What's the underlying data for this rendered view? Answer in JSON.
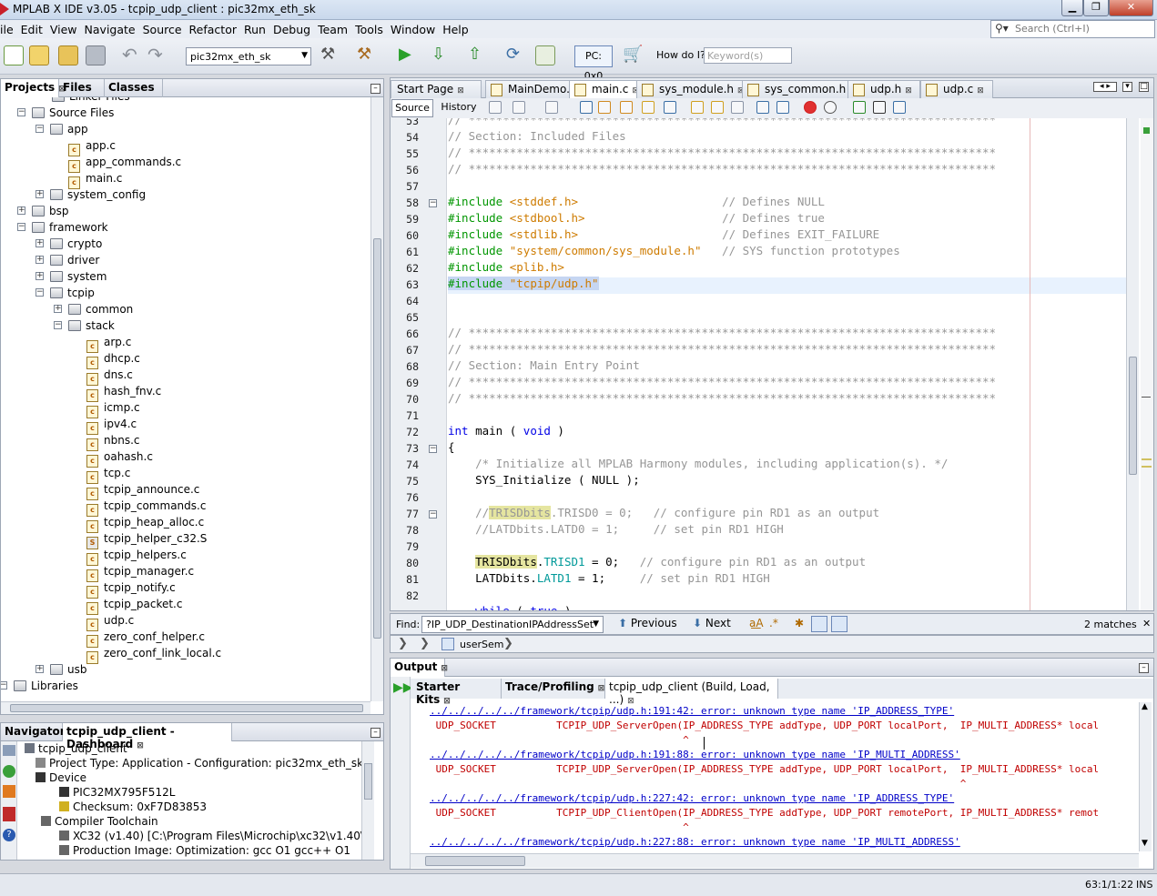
{
  "window": {
    "title": "MPLAB X IDE v3.05 - tcpip_udp_client : pic32mx_eth_sk",
    "min": "▁",
    "max": "❐",
    "close": "✕"
  },
  "menu": [
    "ile",
    "Edit",
    "View",
    "Navigate",
    "Source",
    "Refactor",
    "Run",
    "Debug",
    "Team",
    "Tools",
    "Window",
    "Help"
  ],
  "search": {
    "placeholder": "Search (Ctrl+I)"
  },
  "toolbar": {
    "config": "pic32mx_eth_sk",
    "pc": "PC: 0x0",
    "howdo": "How do I?",
    "keyword_placeholder": "Keyword(s)"
  },
  "projects": {
    "tabs": [
      "Projects",
      "Files",
      "Classes"
    ],
    "tree": [
      {
        "label": "Linker Files",
        "type": "folder"
      },
      {
        "label": "Source Files",
        "type": "folder"
      },
      {
        "label": "app",
        "type": "folder"
      },
      {
        "label": "app.c",
        "type": "file"
      },
      {
        "label": "app_commands.c",
        "type": "file"
      },
      {
        "label": "main.c",
        "type": "file"
      },
      {
        "label": "system_config",
        "type": "folder"
      },
      {
        "label": "bsp",
        "type": "folder"
      },
      {
        "label": "framework",
        "type": "folder"
      },
      {
        "label": "crypto",
        "type": "folder"
      },
      {
        "label": "driver",
        "type": "folder"
      },
      {
        "label": "system",
        "type": "folder"
      },
      {
        "label": "tcpip",
        "type": "folder"
      },
      {
        "label": "common",
        "type": "folder"
      },
      {
        "label": "stack",
        "type": "folder"
      },
      {
        "label": "arp.c",
        "type": "file"
      },
      {
        "label": "dhcp.c",
        "type": "file"
      },
      {
        "label": "dns.c",
        "type": "file"
      },
      {
        "label": "hash_fnv.c",
        "type": "file"
      },
      {
        "label": "icmp.c",
        "type": "file"
      },
      {
        "label": "ipv4.c",
        "type": "file"
      },
      {
        "label": "nbns.c",
        "type": "file"
      },
      {
        "label": "oahash.c",
        "type": "file"
      },
      {
        "label": "tcp.c",
        "type": "file"
      },
      {
        "label": "tcpip_announce.c",
        "type": "file"
      },
      {
        "label": "tcpip_commands.c",
        "type": "file"
      },
      {
        "label": "tcpip_heap_alloc.c",
        "type": "file"
      },
      {
        "label": "tcpip_helper_c32.S",
        "type": "asm"
      },
      {
        "label": "tcpip_helpers.c",
        "type": "file"
      },
      {
        "label": "tcpip_manager.c",
        "type": "file"
      },
      {
        "label": "tcpip_notify.c",
        "type": "file"
      },
      {
        "label": "tcpip_packet.c",
        "type": "file"
      },
      {
        "label": "udp.c",
        "type": "file"
      },
      {
        "label": "zero_conf_helper.c",
        "type": "file"
      },
      {
        "label": "zero_conf_link_local.c",
        "type": "file"
      },
      {
        "label": "usb",
        "type": "folder"
      },
      {
        "label": "Libraries",
        "type": "folder"
      }
    ]
  },
  "dashboard": {
    "tabs": [
      "Navigator",
      "tcpip_udp_client - Dashboard"
    ],
    "items": [
      "tcpip_udp_client",
      "Project Type: Application - Configuration: pic32mx_eth_sk",
      "Device",
      "PIC32MX795F512L",
      "Checksum: 0xF7D83853",
      "Compiler Toolchain",
      "XC32 (v1.40) [C:\\Program Files\\Microchip\\xc32\\v1.40\\bin]",
      "Production Image: Optimization: gcc O1 gcc++ O1"
    ]
  },
  "editor": {
    "tabs": [
      "Start Page",
      "MainDemo.c",
      "main.c",
      "sys_module.h",
      "sys_common.h",
      "udp.h",
      "udp.c"
    ],
    "active_tab": "main.c",
    "views": [
      "Source",
      "History"
    ],
    "line_numbers": [
      "53",
      "54",
      "55",
      "56",
      "57",
      "58",
      "59",
      "60",
      "61",
      "62",
      "63",
      "64",
      "65",
      "66",
      "67",
      "68",
      "69",
      "70",
      "71",
      "72",
      "73",
      "74",
      "75",
      "76",
      "77",
      "78",
      "79",
      "80",
      "81",
      "82"
    ],
    "lines": [
      "// *****************************************************************************",
      "// Section: Included Files",
      "// *****************************************************************************",
      "// *****************************************************************************",
      "",
      "#include <stddef.h>                     // Defines NULL",
      "#include <stdbool.h>                    // Defines true",
      "#include <stdlib.h>                     // Defines EXIT_FAILURE",
      "#include \"system/common/sys_module.h\"   // SYS function prototypes",
      "#include <plib.h>",
      "#include \"tcpip/udp.h\"",
      "",
      "",
      "// *****************************************************************************",
      "// *****************************************************************************",
      "// Section: Main Entry Point",
      "// *****************************************************************************",
      "// *****************************************************************************",
      "",
      "int main ( void )",
      "{",
      "    /* Initialize all MPLAB Harmony modules, including application(s). */",
      "    SYS_Initialize ( NULL );",
      "",
      "    //TRISDbits.TRISD0 = 0;   // configure pin RD1 as an output",
      "    //LATDbits.LATD0 = 1;     // set pin RD1 HIGH",
      "",
      "    TRISDbits.TRISD1 = 0;   // configure pin RD1 as an output",
      "    LATDbits.LATD1 = 1;     // set pin RD1 HIGH",
      "",
      "    while ( true )"
    ]
  },
  "find": {
    "label": "Find:",
    "value": "?IP_UDP_DestinationIPAddressSet",
    "previous": "Previous",
    "next": "Next",
    "matches": "2 matches"
  },
  "breadcrumb": {
    "item": "userSem"
  },
  "output": {
    "title": "Output",
    "tabs": [
      "Starter Kits",
      "Trace/Profiling",
      "tcpip_udp_client (Build, Load, ...)"
    ],
    "lines": [
      {
        "kind": "link",
        "text": "../../../../../framework/tcpip/udp.h:191:42: error: unknown type name 'IP_ADDRESS_TYPE'"
      },
      {
        "kind": "err",
        "text": " UDP_SOCKET          TCPIP_UDP_ServerOpen(IP_ADDRESS_TYPE addType, UDP_PORT localPort,  IP_MULTI_ADDRESS* local"
      },
      {
        "kind": "err",
        "text": "                                          ^"
      },
      {
        "kind": "link",
        "text": "../../../../../framework/tcpip/udp.h:191:88: error: unknown type name 'IP_MULTI_ADDRESS'"
      },
      {
        "kind": "err",
        "text": " UDP_SOCKET          TCPIP_UDP_ServerOpen(IP_ADDRESS_TYPE addType, UDP_PORT localPort,  IP_MULTI_ADDRESS* local"
      },
      {
        "kind": "err",
        "text": "                                                                                        ^"
      },
      {
        "kind": "link",
        "text": "../../../../../framework/tcpip/udp.h:227:42: error: unknown type name 'IP_ADDRESS_TYPE'"
      },
      {
        "kind": "err",
        "text": " UDP_SOCKET          TCPIP_UDP_ClientOpen(IP_ADDRESS_TYPE addType, UDP_PORT remotePort, IP_MULTI_ADDRESS* remot"
      },
      {
        "kind": "err",
        "text": "                                          ^"
      },
      {
        "kind": "link",
        "text": "../../../../../framework/tcpip/udp.h:227:88: error: unknown type name 'IP_MULTI_ADDRESS'"
      }
    ]
  },
  "status": {
    "position": "63:1/1:22",
    "mode": "INS"
  },
  "colors": {
    "accent": "#3a6ea5",
    "error": "#c00000",
    "link": "#0000c8",
    "keyword": "#0000e6",
    "string": "#ce7b00",
    "comment": "#969696"
  }
}
